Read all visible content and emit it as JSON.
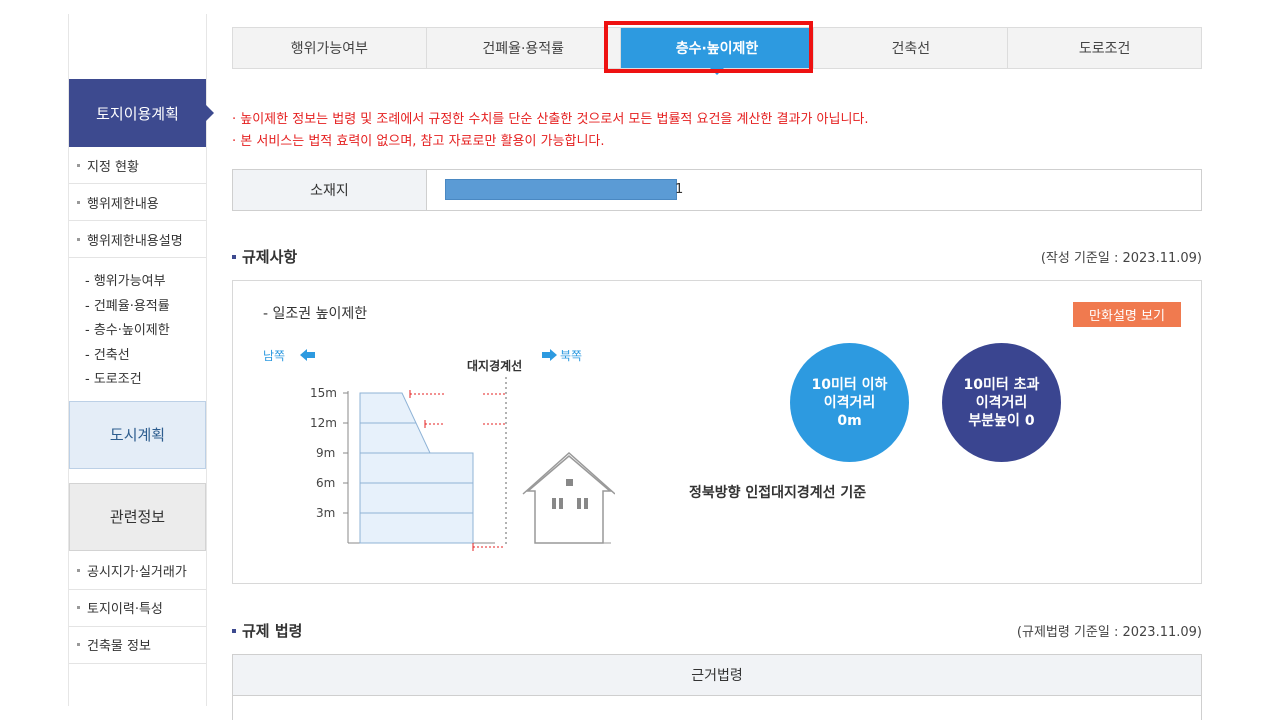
{
  "sidebar": {
    "land_plan": "토지이용계획",
    "items": [
      "지정 현황",
      "행위제한내용",
      "행위제한내용설명"
    ],
    "sub_items": [
      "- 행위가능여부",
      "- 건폐율·용적률",
      "- 층수·높이제한",
      "- 건축선",
      "- 도로조건"
    ],
    "city_plan": "도시계획",
    "related": "관련정보",
    "related_items": [
      "공시지가·실거래가",
      "토지이력·특성",
      "건축물 정보"
    ]
  },
  "tabs": [
    {
      "label": "행위가능여부",
      "active": false
    },
    {
      "label": "건폐율·용적률",
      "active": false
    },
    {
      "label": "층수·높이제한",
      "active": true
    },
    {
      "label": "건축선",
      "active": false
    },
    {
      "label": "도로조건",
      "active": false
    }
  ],
  "notices": [
    "· 높이제한 정보는 법령 및 조례에서 규정한 수치를 단순 산출한 것으로서 모든 법률적 요건을 계산한 결과가 아닙니다.",
    "· 본 서비스는 법적 효력이 없으며, 참고 자료로만 활용이 가능합니다."
  ],
  "address": {
    "label": "소재지",
    "tail": "1"
  },
  "regulation": {
    "title": "규제사항",
    "date": "(작성 기준일 : 2023.11.09)",
    "sub": "- 일조권 높이제한",
    "manga_button": "만화설명 보기",
    "south": "남쪽",
    "north": "북쪽",
    "boundary": "대지경계선",
    "heights": [
      "15m",
      "12m",
      "9m",
      "6m",
      "3m"
    ],
    "circle1": [
      "10미터 이하",
      "이격거리",
      "0m"
    ],
    "circle2": [
      "10미터 초과",
      "이격거리",
      "부분높이 0"
    ],
    "criterion": "정북방향 인접대지경계선 기준"
  },
  "law": {
    "title": "규제 법령",
    "date": "(규제법령 기준일 : 2023.11.09)",
    "column": "근거법령"
  },
  "colors": {
    "active_tab": "#2d9ae0",
    "sidebar_head": "#3d4a8f",
    "notice": "#e52020",
    "manga": "#f07a4f",
    "highlight": "#ee1111"
  }
}
